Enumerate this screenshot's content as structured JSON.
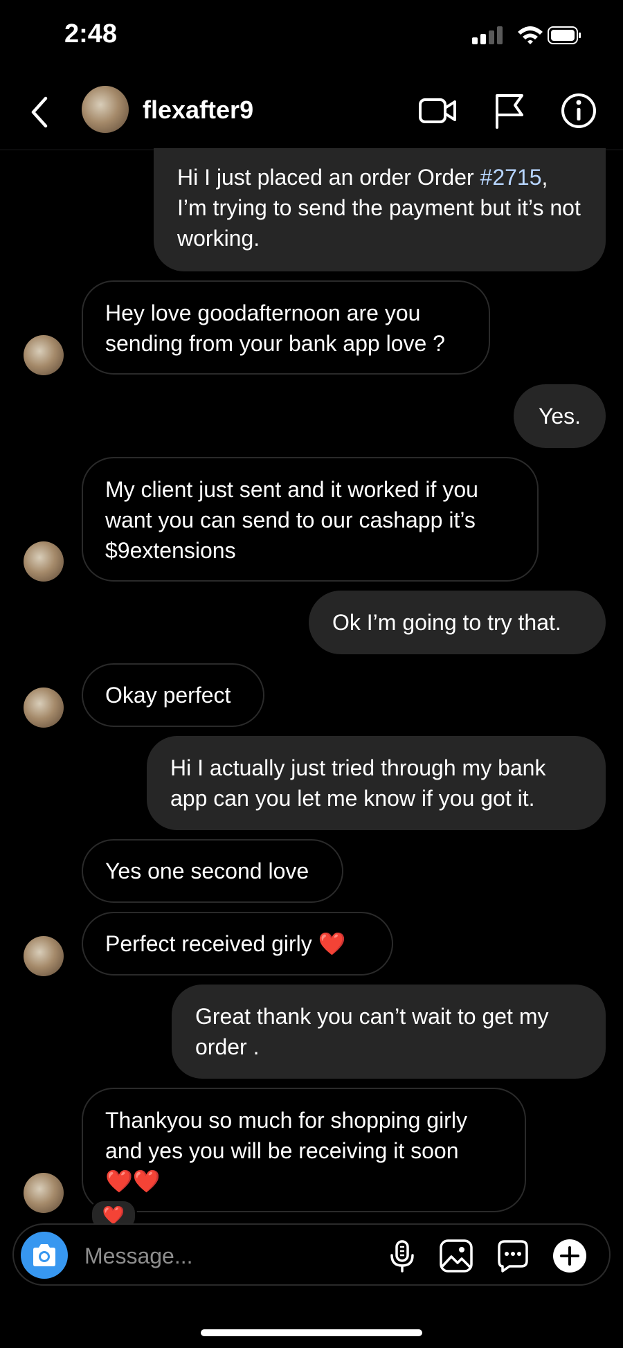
{
  "status_bar": {
    "time": "2:48"
  },
  "header": {
    "username": "flexafter9"
  },
  "messages": [
    {
      "text_pre": "Hi I just placed an order Order ",
      "link": "#2715",
      "text_post": ", I’m trying to send the payment but it’s not working."
    },
    {
      "text": "Hey love goodafternoon are you sending from your bank app love ?"
    },
    {
      "text": "Yes."
    },
    {
      "text": "My client just sent and it worked if you want you can send to our cashapp it’s $9extensions"
    },
    {
      "text": "Ok I’m going to try that."
    },
    {
      "text": "Okay perfect"
    },
    {
      "text": "Hi I actually just tried through my bank app can you let me know if you got it."
    },
    {
      "text": "Yes one second love"
    },
    {
      "text": "Perfect received girly",
      "emoji": "❤️"
    },
    {
      "text": "Great thank you can’t wait to get my order ."
    },
    {
      "text": "Thankyou so much for shopping girly and yes you will be receiving it soon",
      "emoji": "❤️❤️"
    }
  ],
  "reaction": "❤️",
  "composer": {
    "placeholder": "Message..."
  }
}
